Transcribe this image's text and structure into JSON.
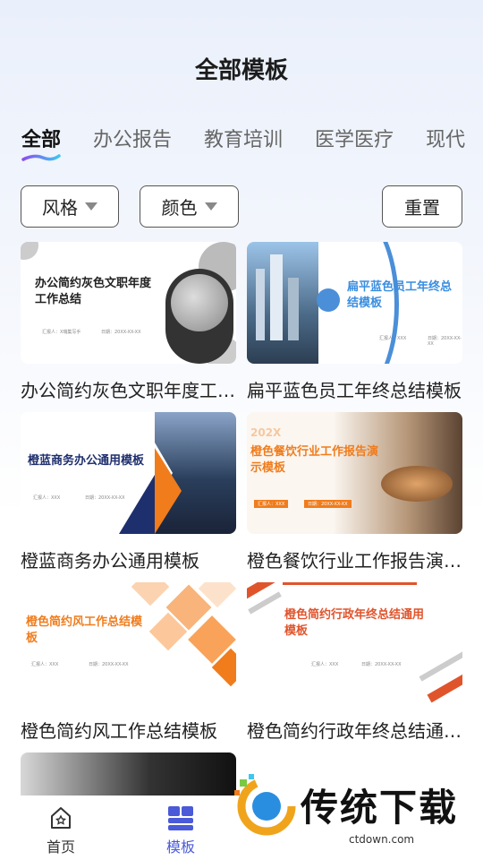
{
  "header": {
    "title": "全部模板"
  },
  "tabs": [
    {
      "label": "全部",
      "active": true
    },
    {
      "label": "办公报告"
    },
    {
      "label": "教育培训"
    },
    {
      "label": "医学医疗"
    },
    {
      "label": "现代"
    }
  ],
  "filters": {
    "style_label": "风格",
    "color_label": "颜色",
    "reset_label": "重置"
  },
  "templates": [
    {
      "title": "办公简约灰色文职年度工作总结模板",
      "thumb_title": "办公简约灰色文职年度工作总结",
      "thumb_reporter": "汇报人：X瑞集写手",
      "thumb_date": "日期：20XX-XX-XX"
    },
    {
      "title": "扁平蓝色员工年终总结模板",
      "thumb_title": "扁平蓝色员工年终总结模板",
      "thumb_reporter": "汇报人：XXX",
      "thumb_date": "日期：20XX-XX-XX"
    },
    {
      "title": "橙蓝商务办公通用模板",
      "thumb_title": "橙蓝商务办公通用模板",
      "thumb_reporter": "汇报人：XXX",
      "thumb_date": "日期：20XX-XX-XX"
    },
    {
      "title": "橙色餐饮行业工作报告演示模板",
      "thumb_year": "202X",
      "thumb_title": "橙色餐饮行业工作报告演示模板",
      "thumb_reporter": "汇报人：XXX",
      "thumb_date": "日期：20XX-XX-XX"
    },
    {
      "title": "橙色简约风工作总结模板",
      "thumb_title": "橙色简约风工作总结模板",
      "thumb_reporter": "汇报人：XXX",
      "thumb_date": "日期：20XX-XX-XX"
    },
    {
      "title": "橙色简约行政年终总结通用模板",
      "thumb_title": "橙色简约行政年终总结通用模板",
      "thumb_reporter": "汇报人：XXX",
      "thumb_date": "日期：20XX-XX-XX"
    }
  ],
  "nav": {
    "home_label": "首页",
    "templates_label": "模板"
  },
  "watermark": {
    "text": "传统下载",
    "url": "ctdown.com"
  },
  "colors": {
    "accent": "#4a5ad8",
    "orange": "#f07c1c",
    "navy": "#1e2f6e"
  }
}
